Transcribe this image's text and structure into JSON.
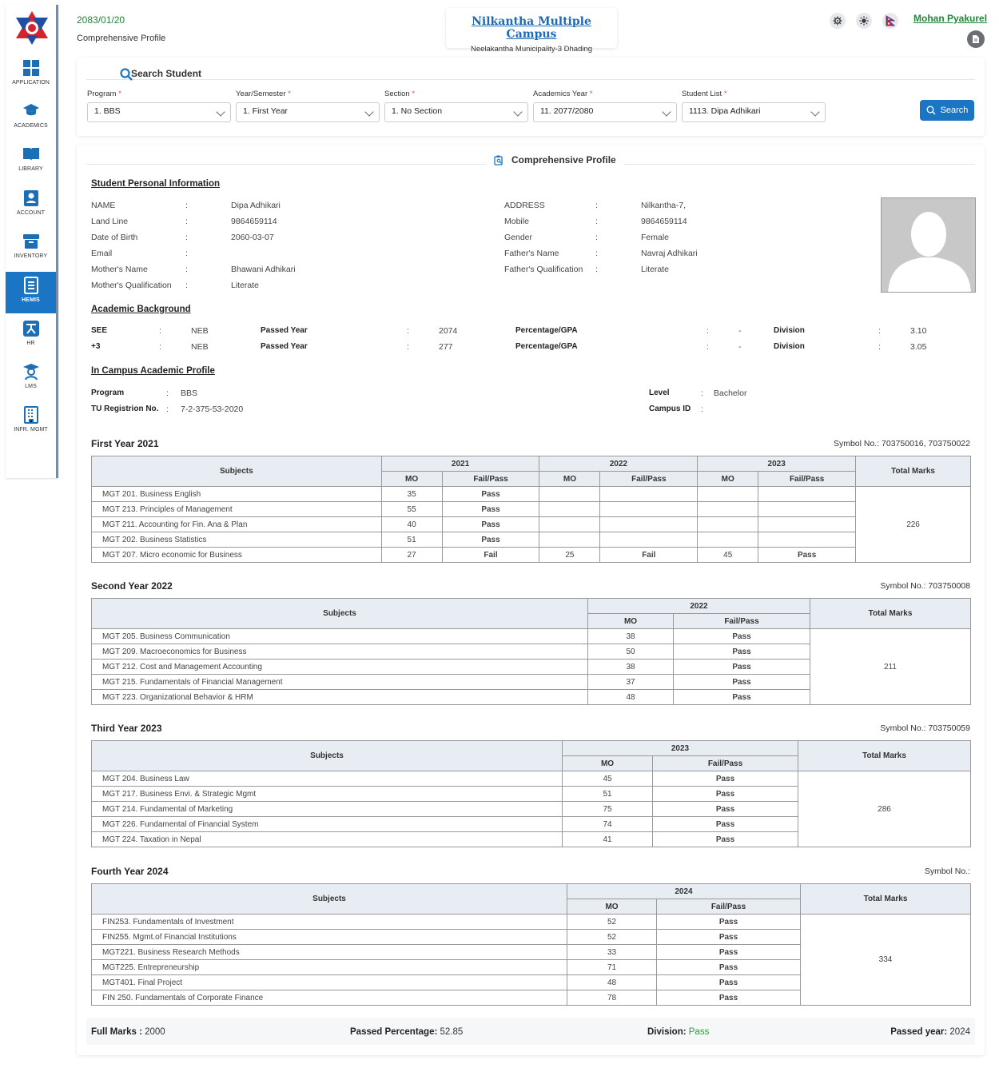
{
  "sidebar": {
    "items": [
      {
        "label": "APPLICATION",
        "icon": "grid-icon"
      },
      {
        "label": "ACADEMICS",
        "icon": "graduation-cap-icon"
      },
      {
        "label": "LIBRARY",
        "icon": "book-icon"
      },
      {
        "label": "ACCOUNT",
        "icon": "account-icon"
      },
      {
        "label": "INVENTORY",
        "icon": "inventory-box-icon"
      },
      {
        "label": "HEMIS",
        "icon": "document-list-icon"
      },
      {
        "label": "HR",
        "icon": "hr-icon"
      },
      {
        "label": "LMS",
        "icon": "teacher-icon"
      },
      {
        "label": "INFR. MGMT",
        "icon": "building-icon"
      }
    ],
    "active": "HEMIS"
  },
  "header": {
    "date": "2083/01/20",
    "subtitle": "Comprehensive Profile",
    "campus_name": "Nilkantha Multiple Campus",
    "campus_address": "Neelakantha Municipality-3 Dhading",
    "user": "Mohan Pyakurel"
  },
  "search": {
    "title": "Search Student",
    "fields": [
      {
        "label": "Program",
        "value": "1. BBS"
      },
      {
        "label": "Year/Semester",
        "value": "1. First Year"
      },
      {
        "label": "Section",
        "value": "1. No Section"
      },
      {
        "label": "Academics Year",
        "value": "11. 2077/2080"
      },
      {
        "label": "Student List",
        "value": "1113. Dipa Adhikari"
      }
    ],
    "button": "Search",
    "required_mark": "*"
  },
  "profile": {
    "title": "Comprehensive Profile",
    "personal_heading": "Student Personal Information",
    "sep": ":",
    "personal_left": [
      {
        "label": "NAME",
        "value": "Dipa Adhikari"
      },
      {
        "label": "Land Line",
        "value": "9864659114"
      },
      {
        "label": "Date of Birth",
        "value": "2060-03-07"
      },
      {
        "label": "Email",
        "value": ""
      },
      {
        "label": "Mother's Name",
        "value": "Bhawani Adhikari"
      },
      {
        "label": "Mother's Qualification",
        "value": "Literate"
      }
    ],
    "personal_right": [
      {
        "label": "ADDRESS",
        "value": "Nilkantha-7,"
      },
      {
        "label": "Mobile",
        "value": "9864659114"
      },
      {
        "label": "Gender",
        "value": "Female"
      },
      {
        "label": "Father's Name",
        "value": "Navraj Adhikari"
      },
      {
        "label": "Father's Qualification",
        "value": "Literate"
      }
    ],
    "academic_heading": "Academic Background",
    "academic": [
      {
        "level": "SEE",
        "board": "NEB",
        "passed_label": "Passed Year",
        "passed_year": "2074",
        "pct_label": "Percentage/GPA",
        "pct": "-",
        "div_label": "Division",
        "division": "3.10"
      },
      {
        "level": "+3",
        "board": "NEB",
        "passed_label": "Passed Year",
        "passed_year": "277",
        "pct_label": "Percentage/GPA",
        "pct": "-",
        "div_label": "Division",
        "division": "3.05"
      }
    ],
    "campus_heading": "In Campus Academic Profile",
    "campus": {
      "program_label": "Program",
      "program": "BBS",
      "tu_label": "TU Registrion No.",
      "tu": "7-2-375-53-2020",
      "level_label": "Level",
      "level": "Bachelor",
      "campus_id_label": "Campus ID",
      "campus_id": ""
    }
  },
  "table_labels": {
    "subjects": "Subjects",
    "mo": "MO",
    "fail_pass": "Fail/Pass",
    "total": "Total Marks"
  },
  "years": [
    {
      "title": "First Year 2021",
      "symbol": "Symbol No.: 703750016, 703750022",
      "attempt_years": [
        "2021",
        "2022",
        "2023"
      ],
      "total": "226",
      "rows": [
        {
          "subject": "MGT 201. Business English",
          "attempts": [
            {
              "mo": "35",
              "result": "Pass"
            },
            {
              "mo": "",
              "result": ""
            },
            {
              "mo": "",
              "result": ""
            }
          ]
        },
        {
          "subject": "MGT 213. Principles of Management",
          "attempts": [
            {
              "mo": "55",
              "result": "Pass"
            },
            {
              "mo": "",
              "result": ""
            },
            {
              "mo": "",
              "result": ""
            }
          ]
        },
        {
          "subject": "MGT 211. Accounting for Fin. Ana & Plan",
          "attempts": [
            {
              "mo": "40",
              "result": "Pass"
            },
            {
              "mo": "",
              "result": ""
            },
            {
              "mo": "",
              "result": ""
            }
          ]
        },
        {
          "subject": "MGT 202. Business Statistics",
          "attempts": [
            {
              "mo": "51",
              "result": "Pass"
            },
            {
              "mo": "",
              "result": ""
            },
            {
              "mo": "",
              "result": ""
            }
          ]
        },
        {
          "subject": "MGT 207. Micro economic for Business",
          "attempts": [
            {
              "mo": "27",
              "result": "Fail"
            },
            {
              "mo": "25",
              "result": "Fail"
            },
            {
              "mo": "45",
              "result": "Pass"
            }
          ]
        }
      ]
    },
    {
      "title": "Second Year 2022",
      "symbol": "Symbol No.: 703750008",
      "attempt_years": [
        "2022"
      ],
      "total": "211",
      "rows": [
        {
          "subject": "MGT 205. Business Communication",
          "attempts": [
            {
              "mo": "38",
              "result": "Pass"
            }
          ]
        },
        {
          "subject": "MGT 209. Macroeconomics for Business",
          "attempts": [
            {
              "mo": "50",
              "result": "Pass"
            }
          ]
        },
        {
          "subject": "MGT 212. Cost and Management Accounting",
          "attempts": [
            {
              "mo": "38",
              "result": "Pass"
            }
          ]
        },
        {
          "subject": "MGT 215. Fundamentals of Financial Management",
          "attempts": [
            {
              "mo": "37",
              "result": "Pass"
            }
          ]
        },
        {
          "subject": "MGT 223. Organizational Behavior & HRM",
          "attempts": [
            {
              "mo": "48",
              "result": "Pass"
            }
          ]
        }
      ]
    },
    {
      "title": "Third Year 2023",
      "symbol": "Symbol No.: 703750059",
      "attempt_years": [
        "2023"
      ],
      "total": "286",
      "rows": [
        {
          "subject": "MGT 204. Business Law",
          "attempts": [
            {
              "mo": "45",
              "result": "Pass"
            }
          ]
        },
        {
          "subject": "MGT 217. Business Envi. & Strategic Mgmt",
          "attempts": [
            {
              "mo": "51",
              "result": "Pass"
            }
          ]
        },
        {
          "subject": "MGT 214. Fundamental of Marketing",
          "attempts": [
            {
              "mo": "75",
              "result": "Pass"
            }
          ]
        },
        {
          "subject": "MGT 226. Fundamental of Financial System",
          "attempts": [
            {
              "mo": "74",
              "result": "Pass"
            }
          ]
        },
        {
          "subject": "MGT 224. Taxation in Nepal",
          "attempts": [
            {
              "mo": "41",
              "result": "Pass"
            }
          ]
        }
      ]
    },
    {
      "title": "Fourth Year 2024",
      "symbol": "Symbol No.:",
      "attempt_years": [
        "2024"
      ],
      "total": "334",
      "rows": [
        {
          "subject": "FIN253. Fundamentals of Investment",
          "attempts": [
            {
              "mo": "52",
              "result": "Pass"
            }
          ]
        },
        {
          "subject": "FIN255. Mgmt.of Financial Institutions",
          "attempts": [
            {
              "mo": "52",
              "result": "Pass"
            }
          ]
        },
        {
          "subject": "MGT221. Business Research Methods",
          "attempts": [
            {
              "mo": "33",
              "result": "Pass"
            }
          ]
        },
        {
          "subject": "MGT225. Entrepreneurship",
          "attempts": [
            {
              "mo": "71",
              "result": "Pass"
            }
          ]
        },
        {
          "subject": "MGT401. Final Project",
          "attempts": [
            {
              "mo": "48",
              "result": "Pass"
            }
          ]
        },
        {
          "subject": "FIN 250. Fundamentals of Corporate Finance",
          "attempts": [
            {
              "mo": "78",
              "result": "Pass"
            }
          ]
        }
      ]
    }
  ],
  "footer": {
    "full_marks_label": "Full Marks :",
    "full_marks": "2000",
    "passed_pct_label": "Passed Percentage:",
    "passed_pct": "52.85",
    "division_label": "Division:",
    "division": "Pass",
    "passed_year_label": "Passed year:",
    "passed_year": "2024"
  }
}
